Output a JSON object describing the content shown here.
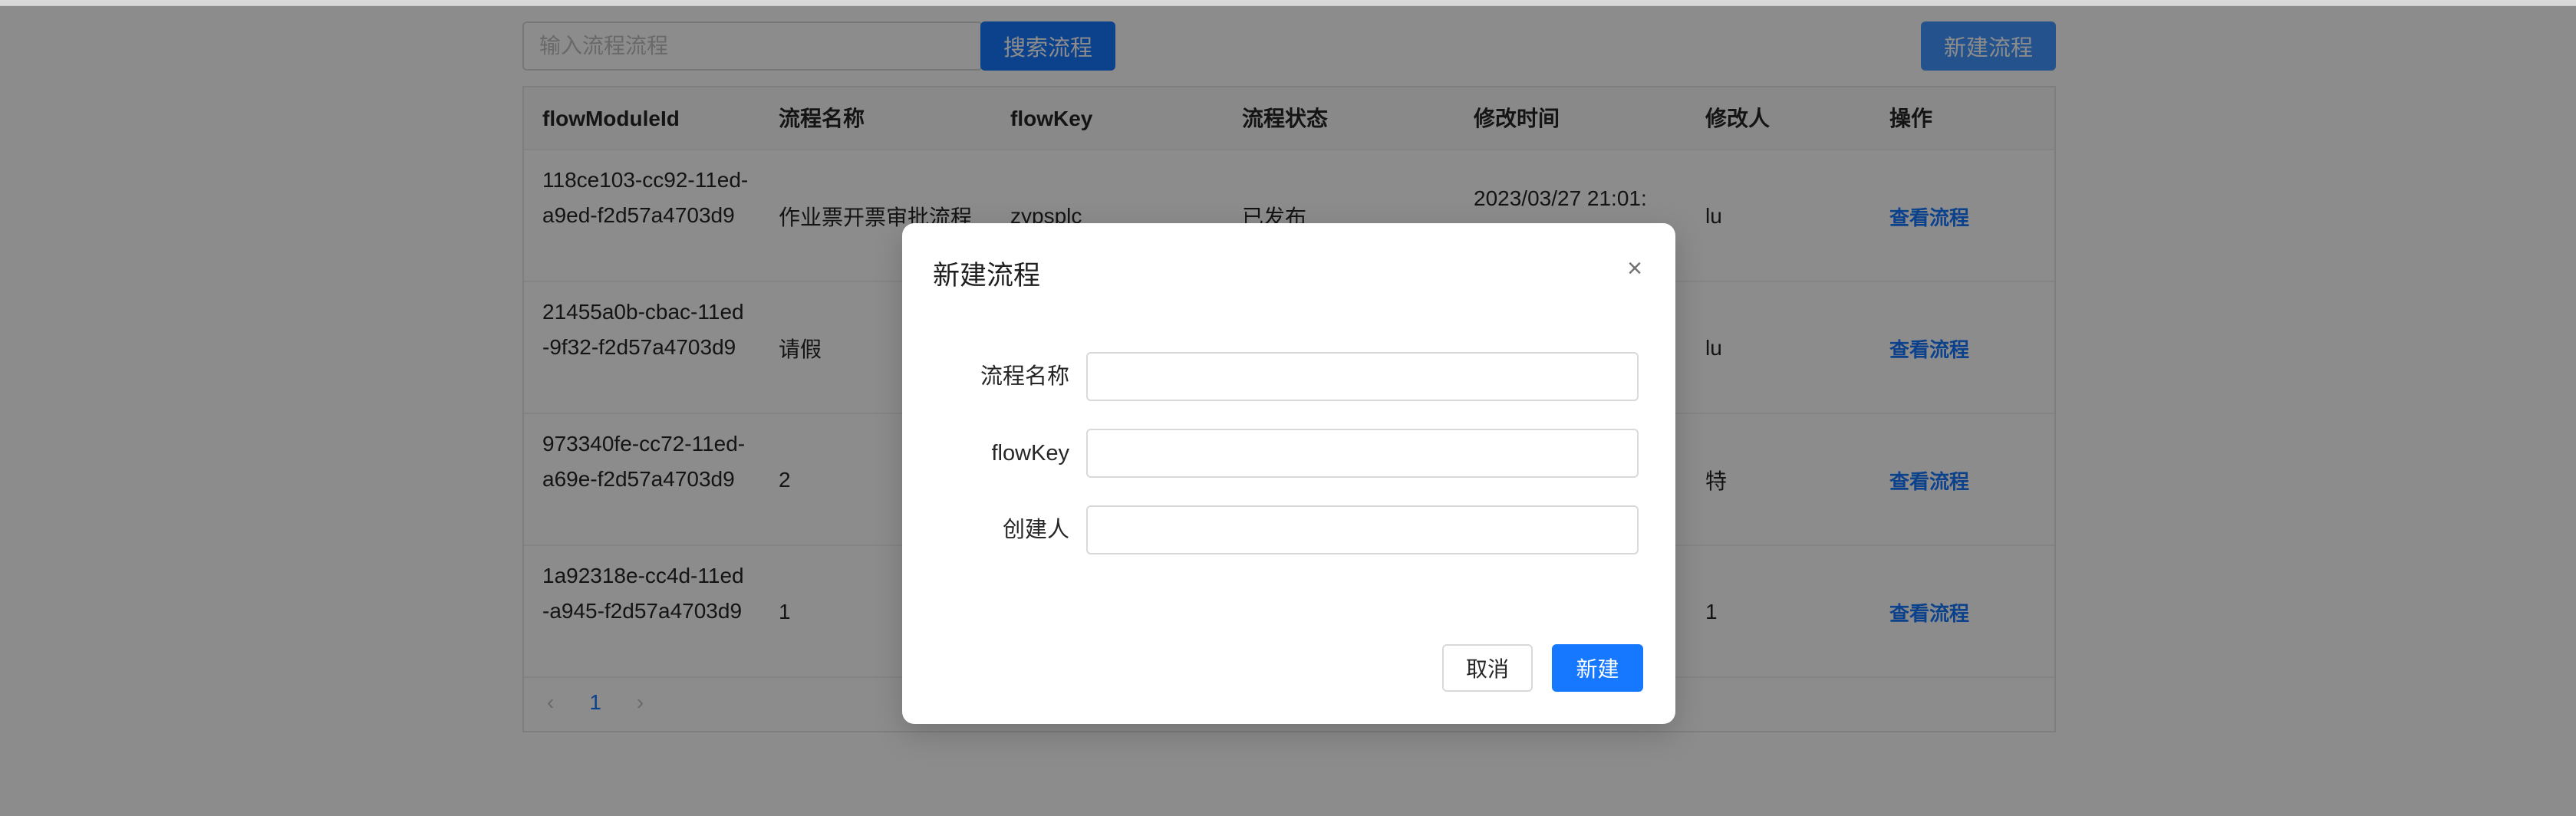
{
  "toolbar": {
    "search_placeholder": "输入流程流程",
    "search_button": "搜索流程",
    "new_flow_button": "新建流程"
  },
  "table": {
    "columns": [
      "flowModuleId",
      "流程名称",
      "flowKey",
      "流程状态",
      "修改时间",
      "修改人",
      "操作"
    ],
    "rows": [
      {
        "id": "118ce103-cc92-11ed-a9ed-f2d57a4703d9",
        "name": "作业票开票审批流程",
        "key": "zypsplc",
        "status": "已发布",
        "time": "2023/03/27 21:01:",
        "modifier": "lu",
        "action": "查看流程"
      },
      {
        "id": "21455a0b-cbac-11ed-9f32-f2d57a4703d9",
        "name": "请假",
        "key": "",
        "status": "",
        "time": "",
        "modifier": "lu",
        "action": "查看流程"
      },
      {
        "id": "973340fe-cc72-11ed-a69e-f2d57a4703d9",
        "name": "2",
        "key": "",
        "status": "",
        "time": "",
        "modifier": "特",
        "action": "查看流程"
      },
      {
        "id": "1a92318e-cc4d-11ed-a945-f2d57a4703d9",
        "name": "1",
        "key": "",
        "status": "",
        "time": "",
        "modifier": "1",
        "action": "查看流程"
      }
    ]
  },
  "pagination": {
    "prev_icon": "‹",
    "current_page": "1",
    "next_icon": "›"
  },
  "modal": {
    "title": "新建流程",
    "close_icon": "×",
    "fields": [
      {
        "label": "流程名称",
        "value": ""
      },
      {
        "label": "flowKey",
        "value": ""
      },
      {
        "label": "创建人",
        "value": ""
      }
    ],
    "cancel_button": "取消",
    "create_button": "新建"
  },
  "colors": {
    "primary": "#1677ff",
    "mask": "rgba(0,0,0,0.45)"
  }
}
